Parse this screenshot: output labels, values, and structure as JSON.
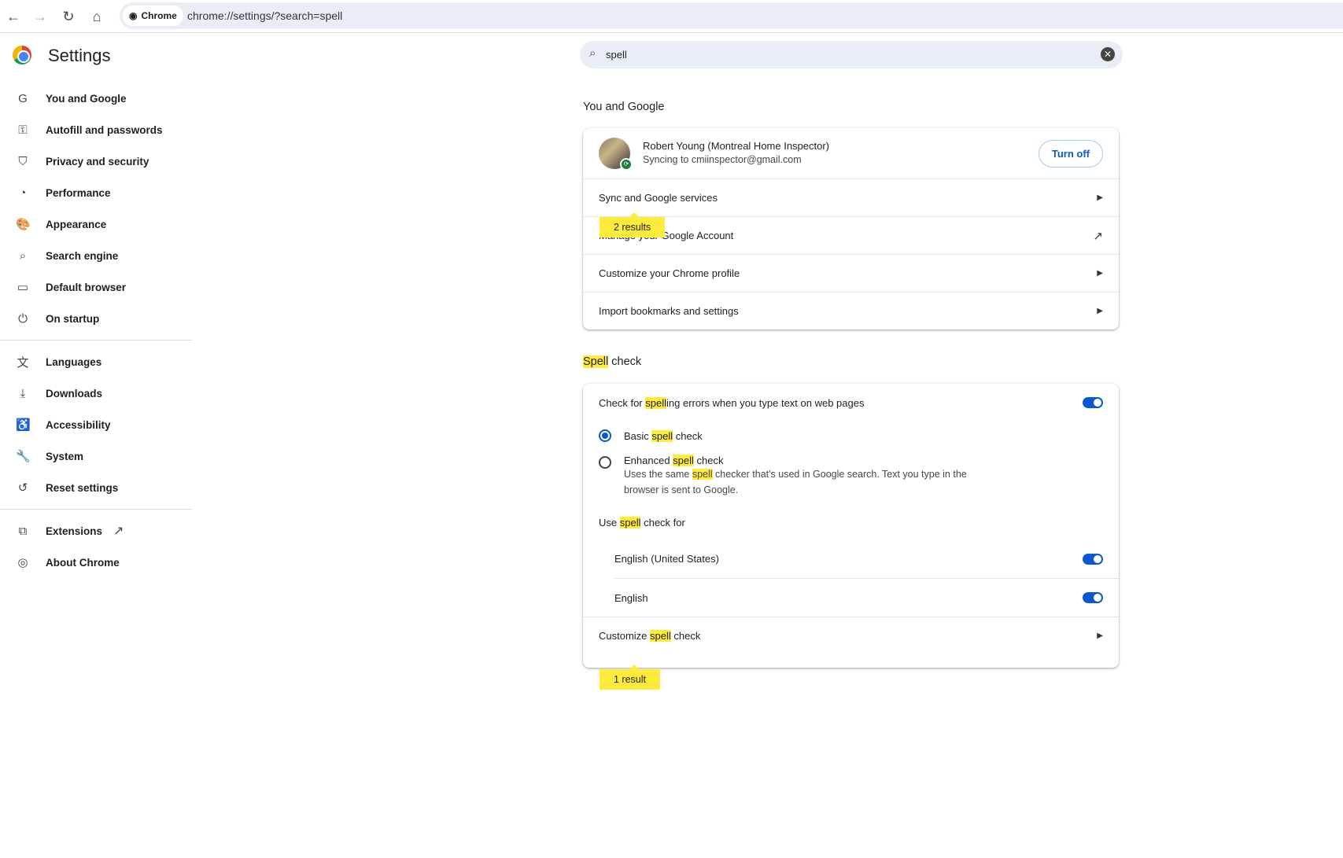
{
  "browser": {
    "chip": "Chrome",
    "url": "chrome://settings/?search=spell"
  },
  "header": {
    "title": "Settings"
  },
  "sidebar": {
    "items": [
      {
        "label": "You and Google",
        "icon": "G"
      },
      {
        "label": "Autofill and passwords",
        "icon": "⚿"
      },
      {
        "label": "Privacy and security",
        "icon": "⛉"
      },
      {
        "label": "Performance",
        "icon": "◔"
      },
      {
        "label": "Appearance",
        "icon": "🎨"
      },
      {
        "label": "Search engine",
        "icon": "⌕"
      },
      {
        "label": "Default browser",
        "icon": "▭"
      },
      {
        "label": "On startup",
        "icon": "⏻"
      },
      {
        "label": "Languages",
        "icon": "文"
      },
      {
        "label": "Downloads",
        "icon": "⤓"
      },
      {
        "label": "Accessibility",
        "icon": "♿"
      },
      {
        "label": "System",
        "icon": "🔧"
      },
      {
        "label": "Reset settings",
        "icon": "↺"
      },
      {
        "label": "Extensions",
        "icon": "⧉"
      },
      {
        "label": "About Chrome",
        "icon": "◎"
      }
    ]
  },
  "search": {
    "value": "spell"
  },
  "you_and_google": {
    "heading": "You and Google",
    "name": "Robert Young (Montreal Home Inspector)",
    "sync": "Syncing to cmiinspector@gmail.com",
    "turn_off": "Turn off",
    "rows": [
      "Sync and Google services",
      "Manage your Google Account",
      "Customize your Chrome profile",
      "Import bookmarks and settings"
    ],
    "bubble": "2 results"
  },
  "spell": {
    "heading_hl": "Spell",
    "heading_rest": " check",
    "check_pre": "Check for ",
    "check_hl": "spell",
    "check_post": "ing errors when you type text on web pages",
    "basic_pre": "Basic ",
    "basic_hl": "spell",
    "basic_post": " check",
    "enh_pre": "Enhanced ",
    "enh_hl": "spell",
    "enh_post": " check",
    "desc_pre": "Uses the same ",
    "desc_hl": "spell",
    "desc_post": " checker that's used in Google search. Text you type in the browser is sent to Google.",
    "use_pre": "Use ",
    "use_hl": "spell",
    "use_post": " check for",
    "lang1": "English (United States)",
    "lang2": "English",
    "cust_pre": "Customize ",
    "cust_hl": "spell",
    "cust_post": " check",
    "bubble": "1 result",
    "accent": "#0b57d0",
    "highlight": "#ffeb3b"
  }
}
